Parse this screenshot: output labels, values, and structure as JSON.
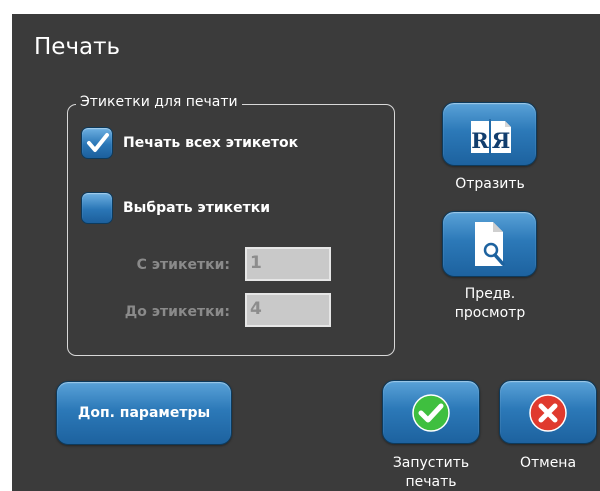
{
  "dialog": {
    "title": "Печать"
  },
  "labels_group": {
    "legend": "Этикетки для печати",
    "print_all": {
      "label": "Печать всех этикеток",
      "checked": true
    },
    "select_labels": {
      "label": "Выбрать этикетки",
      "checked": false
    },
    "from_label": "С этикетки:",
    "from_value": "1",
    "to_label": "До этикетки:",
    "to_value": "4"
  },
  "buttons": {
    "mirror": {
      "label": "Отразить"
    },
    "preview": {
      "label_line1": "Предв.",
      "label_line2": "просмотр"
    },
    "more_options": {
      "label": "Доп. параметры"
    },
    "start_print": {
      "label_line1": "Запустить",
      "label_line2": "печать"
    },
    "cancel": {
      "label": "Отмена"
    }
  },
  "colors": {
    "background": "#3b3b3b",
    "button": "#2c79b8",
    "confirm": "#3fbf3f",
    "cancel": "#e03a2e"
  },
  "icons": {
    "mirror": "mirror-RR-icon",
    "preview": "document-magnifier-icon",
    "start": "check-icon",
    "cancel": "x-icon"
  }
}
